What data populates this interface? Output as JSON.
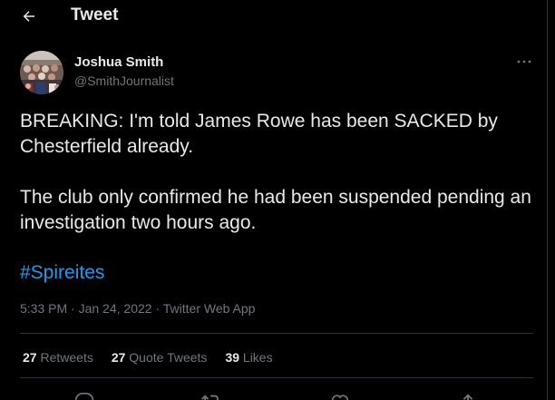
{
  "header": {
    "back_icon": "arrow-left-icon",
    "title": "Tweet"
  },
  "author": {
    "name": "Joshua Smith",
    "handle": "@SmithJournalist",
    "avatar": "crowd-photo-avatar"
  },
  "tweet": {
    "paragraph1": "BREAKING: I'm told James Rowe has been SACKED by Chesterfield already.",
    "paragraph2": "The club only confirmed he had been suspended pending an investigation two hours ago.",
    "hashtag": "#Spireites",
    "time": "5:33 PM",
    "separator": "·",
    "date": "Jan 24, 2022",
    "source": "Twitter Web App"
  },
  "stats": [
    {
      "count": "27",
      "label": "Retweets"
    },
    {
      "count": "27",
      "label": "Quote Tweets"
    },
    {
      "count": "39",
      "label": "Likes"
    }
  ],
  "actions": [
    "reply-icon",
    "retweet-icon",
    "like-icon",
    "share-icon"
  ],
  "colors": {
    "background": "#000000",
    "text": "#e7e9ea",
    "secondary": "#71767b",
    "link": "#1d9bf0",
    "border": "#2f3336"
  }
}
